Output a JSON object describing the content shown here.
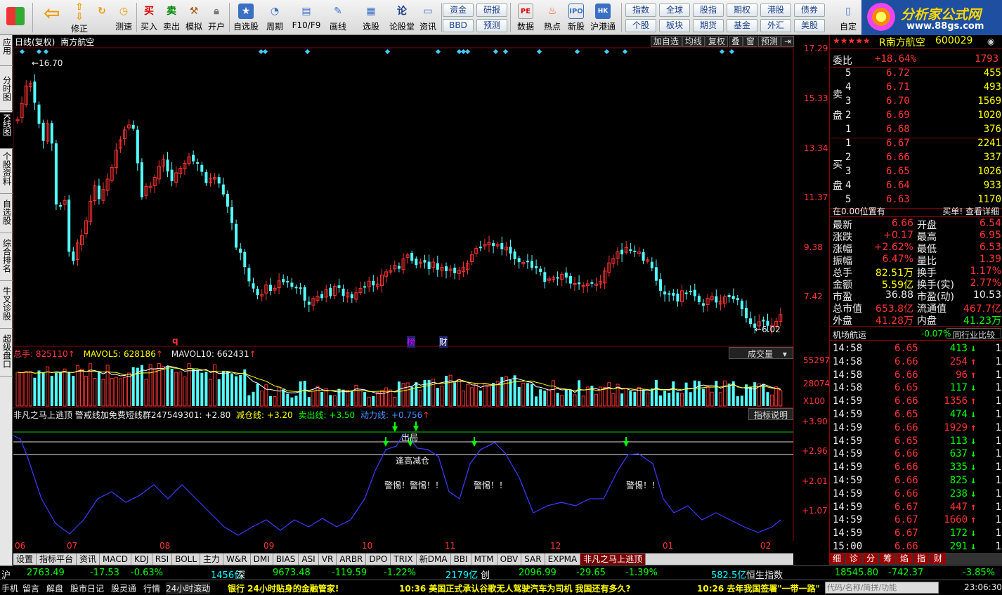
{
  "toolbar": {
    "buttons": [
      "买入",
      "卖出",
      "模拟",
      "开户",
      "自选股",
      "周期",
      "F10/F9",
      "画线",
      "选股",
      "论股堂",
      "资讯",
      "数据",
      "热点",
      "新股",
      "沪港通",
      "自定"
    ],
    "nav": [
      "修正",
      "测速"
    ],
    "small_buttons": [
      "资金",
      "研报",
      "BBD",
      "预测",
      "指数",
      "全球",
      "股指",
      "期权",
      "港股",
      "债券",
      "个股",
      "板块",
      "期货",
      "基金",
      "外汇",
      "美股"
    ],
    "logo_title": "分析家公式网",
    "logo_url": "www.88gs.com"
  },
  "left_tabs": [
    "应用",
    "分时图",
    "K线图",
    "个股资料",
    "自选股",
    "综合排名",
    "牛叉诊股",
    "超级盘口"
  ],
  "chart": {
    "header_left": "日线(复权)",
    "stock_name": "南方航空",
    "header_buttons": [
      "加自选",
      "均线",
      "复权",
      "叠",
      "窗",
      "预测"
    ],
    "price_axis": [
      "17.29",
      "15.33",
      "13.34",
      "11.37",
      "9.38",
      "7.42"
    ],
    "high_label": "16.70",
    "low_label": "6.02",
    "markers": [
      "q",
      "榜",
      "财"
    ],
    "volume": {
      "total_label": "总手:",
      "total_value": "825110",
      "mavol5_label": "MAVOL5:",
      "mavol5_value": "628186",
      "mavol10_label": "MAVOL10:",
      "mavol10_value": "662431",
      "dropdown": "成交量",
      "axis": [
        "55297",
        "28074",
        "X100"
      ]
    },
    "indicator": {
      "title": "非凡之马上逃顶",
      "warn_label": "警戒线加免费短线群247549301:",
      "warn_value": "+2.80",
      "reduce_label": "减仓线:",
      "reduce_value": "+3.20",
      "sell_label": "卖出线:",
      "sell_value": "+3.50",
      "power_label": "动力线:",
      "power_value": "+0.756",
      "help": "指标说明",
      "axis": [
        "+3.90",
        "+2.96",
        "+2.01",
        "+1.07"
      ],
      "annotations": [
        "出局",
        "逢高减仓",
        "警惕！警惕！！",
        "警惕！！",
        "警惕！！"
      ]
    },
    "x_axis": [
      "06",
      "07",
      "08",
      "09",
      "10",
      "11",
      "12",
      "01",
      "02"
    ]
  },
  "index_tabs": [
    "设置",
    "指标平台",
    "资讯",
    "MACD",
    "KDJ",
    "RSI",
    "BOLL",
    "主力",
    "W&R",
    "DMI",
    "BIAS",
    "ASI",
    "VR",
    "ARBR",
    "DPO",
    "TRIX",
    "新DMA",
    "BBI",
    "MTM",
    "OBV",
    "SAR",
    "EXPMA",
    "非凡之马上逃顶"
  ],
  "quote": {
    "stars": "★★★★★",
    "name": "R南方航空",
    "code": "600029",
    "weibi_label": "委比",
    "weibi_value": "+18.64%",
    "weibi_diff": "1793",
    "sell_label": "卖盘",
    "buy_label": "买盘",
    "sells": [
      [
        "5",
        "6.72",
        "455"
      ],
      [
        "4",
        "6.71",
        "493"
      ],
      [
        "3",
        "6.70",
        "1569"
      ],
      [
        "2",
        "6.69",
        "1020"
      ],
      [
        "1",
        "6.68",
        "376"
      ]
    ],
    "buys": [
      [
        "1",
        "6.67",
        "2241"
      ],
      [
        "2",
        "6.66",
        "337"
      ],
      [
        "3",
        "6.65",
        "1026"
      ],
      [
        "4",
        "6.64",
        "933"
      ],
      [
        "5",
        "6.63",
        "1170"
      ]
    ],
    "position_text": "在0.00位置有",
    "position_action": "买单! 查看详细",
    "stats": [
      [
        "最新",
        "6.66",
        "开盘",
        "6.54"
      ],
      [
        "涨跌",
        "+0.17",
        "最高",
        "6.95"
      ],
      [
        "涨幅",
        "+2.62%",
        "最低",
        "6.53"
      ],
      [
        "振幅",
        "6.47%",
        "量比",
        "1.39"
      ],
      [
        "总手",
        "82.51万",
        "换手",
        "1.17%"
      ],
      [
        "金额",
        "5.59亿",
        "换手(实)",
        "2.77%"
      ],
      [
        "市盈",
        "36.88",
        "市盈(动)",
        "10.53"
      ],
      [
        "总市值",
        "653.8亿",
        "流通值",
        "467.7亿"
      ],
      [
        "外盘",
        "41.28万",
        "内盘",
        "41.23万"
      ]
    ],
    "sector_label": "机场航运",
    "sector_value": "-0.07%",
    "sector_link": "同行业比较",
    "ticks": [
      [
        "14:58",
        "6.65",
        "413",
        "↓",
        "1"
      ],
      [
        "14:58",
        "6.66",
        "254",
        "↑",
        "1"
      ],
      [
        "14:58",
        "6.66",
        "96",
        "↑",
        "1"
      ],
      [
        "14:58",
        "6.65",
        "117",
        "↓",
        "1"
      ],
      [
        "14:59",
        "6.66",
        "1356",
        "↑",
        "1"
      ],
      [
        "14:59",
        "6.65",
        "474",
        "↓",
        "1"
      ],
      [
        "14:59",
        "6.66",
        "1929",
        "↑",
        "1"
      ],
      [
        "14:59",
        "6.65",
        "113",
        "↓",
        "1"
      ],
      [
        "14:59",
        "6.66",
        "637",
        "↓",
        "1"
      ],
      [
        "14:59",
        "6.66",
        "335",
        "↓",
        "1"
      ],
      [
        "14:59",
        "6.66",
        "825",
        "↓",
        "1"
      ],
      [
        "14:59",
        "6.66",
        "238",
        "↓",
        "1"
      ],
      [
        "14:59",
        "6.67",
        "447",
        "↑",
        "1"
      ],
      [
        "14:59",
        "6.67",
        "1660",
        "↑",
        "1"
      ],
      [
        "14:59",
        "6.67",
        "172",
        "↓",
        "1"
      ],
      [
        "15:00",
        "6.66",
        "291",
        "↓",
        "1"
      ]
    ],
    "bottom_tabs": [
      "细",
      "诊",
      "分",
      "筹",
      "焰",
      "指",
      "财"
    ]
  },
  "status": {
    "sh_label": "沪",
    "sh_index": "2763.49",
    "sh_change": "-17.53",
    "sh_pct": "-0.63%",
    "sh_amount": "1456亿",
    "sz_label": "深",
    "sz_index": "9673.48",
    "sz_change": "-119.59",
    "sz_pct": "-1.22%",
    "sz_amount": "2179亿",
    "cy_label": "创",
    "cy_index": "2096.99",
    "cy_change": "-29.65",
    "cy_pct": "-1.39%",
    "cy_amount": "582.5亿",
    "hk_label": "恒生指数",
    "hk_index": "18545.80",
    "hk_change": "-742.37",
    "hk_pct": "-3.85%"
  },
  "bottom": {
    "items": [
      "手机",
      "留言",
      "解盘",
      "股市日记",
      "股灵通",
      "行情",
      "24小时滚动"
    ],
    "ticker1": "银行 24小时贴身的金融管家!",
    "news1": "10:36 美国正式承认谷歌无人驾驶汽车为司机 我国还有多久?",
    "news2": "10:26 去年我国签署\"一带一路\"",
    "search_placeholder": "代码/名称/简拼/功能",
    "clock": "23:06:30"
  },
  "colors": {
    "up": "#ff3333",
    "down": "#54ffff",
    "ma5": "#ffffff",
    "ma10": "#ffff00",
    "line": "#3b3bff"
  }
}
